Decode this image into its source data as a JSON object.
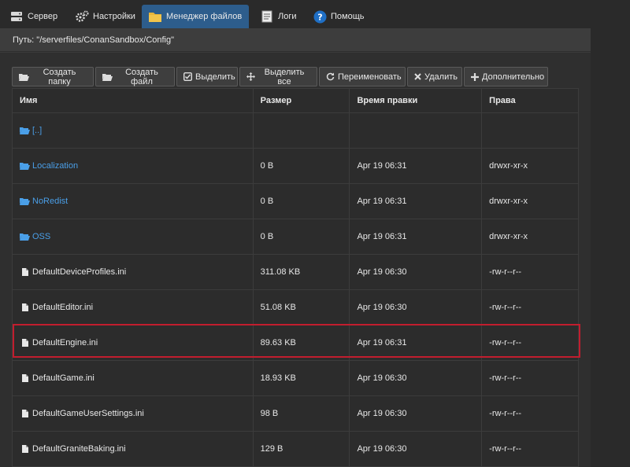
{
  "nav": {
    "tabs": [
      {
        "label": "Сервер",
        "icon": "server-icon"
      },
      {
        "label": "Настройки",
        "icon": "gears-icon"
      },
      {
        "label": "Менеджер файлов",
        "icon": "folder-icon",
        "active": true
      },
      {
        "label": "Логи",
        "icon": "log-icon"
      },
      {
        "label": "Помощь",
        "icon": "help-icon"
      }
    ]
  },
  "path": {
    "text": "Путь: \"/serverfiles/ConanSandbox/Config\""
  },
  "toolbar": {
    "create_folder": "Создать папку",
    "create_file": "Создать файл",
    "select": "Выделить",
    "select_all": "Выделить все",
    "rename": "Переименовать",
    "delete": "Удалить",
    "more": "Дополнительно"
  },
  "table": {
    "headers": [
      "Имя",
      "Размер",
      "Время правки",
      "Права"
    ],
    "rows": [
      {
        "name": "[..]",
        "type": "dir",
        "size": "",
        "modified": "",
        "perms": ""
      },
      {
        "name": "Localization",
        "type": "dir",
        "size": "0 B",
        "modified": "Apr 19 06:31",
        "perms": "drwxr-xr-x"
      },
      {
        "name": "NoRedist",
        "type": "dir",
        "size": "0 B",
        "modified": "Apr 19 06:31",
        "perms": "drwxr-xr-x"
      },
      {
        "name": "OSS",
        "type": "dir",
        "size": "0 B",
        "modified": "Apr 19 06:31",
        "perms": "drwxr-xr-x"
      },
      {
        "name": "DefaultDeviceProfiles.ini",
        "type": "file",
        "size": "311.08 KB",
        "modified": "Apr 19 06:30",
        "perms": "-rw-r--r--"
      },
      {
        "name": "DefaultEditor.ini",
        "type": "file",
        "size": "51.08 KB",
        "modified": "Apr 19 06:30",
        "perms": "-rw-r--r--"
      },
      {
        "name": "DefaultEngine.ini",
        "type": "file",
        "size": "89.63 KB",
        "modified": "Apr 19 06:31",
        "perms": "-rw-r--r--",
        "highlighted": true
      },
      {
        "name": "DefaultGame.ini",
        "type": "file",
        "size": "18.93 KB",
        "modified": "Apr 19 06:30",
        "perms": "-rw-r--r--"
      },
      {
        "name": "DefaultGameUserSettings.ini",
        "type": "file",
        "size": "98 B",
        "modified": "Apr 19 06:30",
        "perms": "-rw-r--r--"
      },
      {
        "name": "DefaultGraniteBaking.ini",
        "type": "file",
        "size": "129 B",
        "modified": "Apr 19 06:30",
        "perms": "-rw-r--r--"
      }
    ]
  },
  "colors": {
    "accent": "#2d5d8c",
    "folder": "#4a9fe8",
    "highlight": "#c21d2e"
  }
}
